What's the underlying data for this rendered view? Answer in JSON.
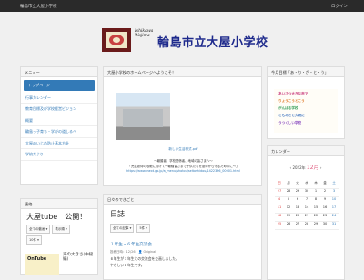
{
  "topbar": {
    "site_name": "輪島市立大屋小学校",
    "login": "ログイン"
  },
  "header": {
    "logo_sub1": "Ishikawa",
    "logo_sub2": "Wajima",
    "title": "輪島市立大屋小学校"
  },
  "menu": {
    "heading": "メニュー",
    "items": [
      {
        "label": "トップページ"
      },
      {
        "label": "行事カレンダー"
      },
      {
        "label": "教育目標及び学校経営ビジョン"
      },
      {
        "label": "概要"
      },
      {
        "label": "輪島っ子育ち・学びの道しるべ"
      },
      {
        "label": "大屋のいじめ防止基本方針"
      },
      {
        "label": "学校だより"
      }
    ]
  },
  "notice": {
    "heading": "連絡",
    "tube_title": "大屋tube　公開！",
    "filters": [
      "全ての動画 ▾",
      "表示順 ▾",
      "10件 ▾"
    ],
    "thumb_label": "OnTube",
    "thumb2": "海の大きさ(中級編)"
  },
  "welcome": {
    "heading": "大屋小学校のホームページへようこそ！",
    "pdf_link": "新しい生活様式.pdf",
    "cap1": "～報護者、学校関係者、地域の皆さまへ～",
    "cap2": "「児童虐待の根絶に向けて～報種皆さまで子供たちを虐待から守るためのに～」",
    "cap3": "https://www.mext.go.jp/a_menu/shotou/seitoshidou/1422396_00001.html"
  },
  "diary": {
    "heading": "日々のできごと",
    "title": "日誌",
    "filters": [
      "全ての記事 ▾",
      "5件 ▾"
    ],
    "post_title": "１年生・６年生交流会",
    "post_meta": "投稿日時：12/26　👤 Original",
    "post_body1": "６年生が１年生との交流会を企画しました。",
    "post_body2": "やさしい６年生です。"
  },
  "motto": {
    "heading": "今月目標「あ・り・が・と・う」",
    "lines": [
      "あいさつ大きな声で",
      "りょうこうとこう",
      "がんばる学校",
      "とものこと大切に",
      "うつくしい学校"
    ]
  },
  "calendar": {
    "heading": "カレンダー",
    "year": "2022年",
    "month": "12月",
    "weekdays": [
      "日",
      "月",
      "火",
      "水",
      "木",
      "金",
      "土"
    ],
    "weeks": [
      [
        "27",
        "28",
        "29",
        "30",
        "1",
        "2",
        "3"
      ],
      [
        "4",
        "5",
        "6",
        "7",
        "8",
        "9",
        "10"
      ],
      [
        "11",
        "12",
        "13",
        "14",
        "15",
        "16",
        "17"
      ],
      [
        "18",
        "19",
        "20",
        "21",
        "22",
        "23",
        "24"
      ],
      [
        "25",
        "26",
        "27",
        "28",
        "29",
        "30",
        "31"
      ]
    ]
  }
}
